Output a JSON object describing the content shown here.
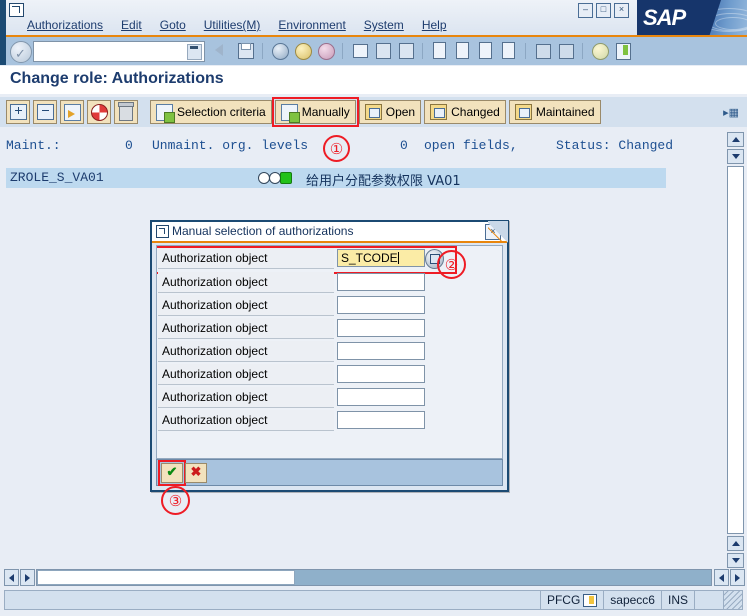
{
  "window": {
    "system_icon": "sap-session-icon",
    "minimize": "–",
    "maximize": "□",
    "close": "×",
    "logo_text": "SAP"
  },
  "menu": {
    "items": [
      {
        "label": "Authorizations",
        "accel": "A"
      },
      {
        "label": "Edit",
        "accel": "E"
      },
      {
        "label": "Goto",
        "accel": "G"
      },
      {
        "label": "Utilities(M)",
        "accel": "M"
      },
      {
        "label": "Environment",
        "accel": "v"
      },
      {
        "label": "System",
        "accel": "y"
      },
      {
        "label": "Help",
        "accel": "H"
      }
    ]
  },
  "command_bar": {
    "command_value": "",
    "command_placeholder": "",
    "enter_icon": "green-check-icon",
    "dropdown_icon": "command-history-icon",
    "icons": [
      "back-icon",
      "save-icon",
      "exit-icon",
      "up-icon",
      "cancel-icon",
      "print-icon",
      "find-icon",
      "find-next-icon",
      "first-page-icon",
      "previous-page-icon",
      "next-page-icon",
      "last-page-icon",
      "new-session-icon",
      "create-shortcut-icon",
      "help-icon",
      "customize-icon"
    ]
  },
  "page": {
    "title": "Change role: Authorizations",
    "right_marker": "list-options-icon"
  },
  "app_toolbar": {
    "icon_buttons": [
      {
        "name": "expand-all-button",
        "icon": "expand-plus-icon"
      },
      {
        "name": "collapse-all-button",
        "icon": "collapse-minus-icon"
      },
      {
        "name": "display-change-button",
        "icon": "document-arrow-icon"
      },
      {
        "name": "traffic-light-button",
        "icon": "red-white-ball-icon"
      },
      {
        "name": "delete-button",
        "icon": "trash-icon"
      }
    ],
    "buttons": [
      {
        "label": "Selection criteria",
        "icon": "selection-criteria-icon",
        "highlighted": false
      },
      {
        "label": "Manually",
        "icon": "manually-icon",
        "highlighted": true
      },
      {
        "label": "Open",
        "icon": "open-icon",
        "highlighted": false
      },
      {
        "label": "Changed",
        "icon": "changed-icon",
        "highlighted": false
      },
      {
        "label": "Maintained",
        "icon": "maintained-icon",
        "highlighted": false
      }
    ]
  },
  "info_line": {
    "maint_label": "Maint.:",
    "maint_count": "0",
    "unmaint_text": "Unmaint. org. levels",
    "open_count": "0",
    "open_text": "open fields,",
    "status_text": "Status: Changed"
  },
  "role_row": {
    "role_name": "ZROLE_S_VA01",
    "description": "给用户分配参数权限 VA01",
    "traffic_light": "green"
  },
  "dialog": {
    "title": "Manual selection of authorizations",
    "close_label": "×",
    "rows": [
      {
        "label": "Authorization object",
        "value": "S_TCODE",
        "filled": true,
        "has_help": true
      },
      {
        "label": "Authorization object",
        "value": "",
        "filled": false,
        "has_help": false
      },
      {
        "label": "Authorization object",
        "value": "",
        "filled": false,
        "has_help": false
      },
      {
        "label": "Authorization object",
        "value": "",
        "filled": false,
        "has_help": false
      },
      {
        "label": "Authorization object",
        "value": "",
        "filled": false,
        "has_help": false
      },
      {
        "label": "Authorization object",
        "value": "",
        "filled": false,
        "has_help": false
      },
      {
        "label": "Authorization object",
        "value": "",
        "filled": false,
        "has_help": false
      },
      {
        "label": "Authorization object",
        "value": "",
        "filled": false,
        "has_help": false
      }
    ],
    "footer": {
      "confirm_label": "✔",
      "cancel_label": "✖"
    }
  },
  "annotations": [
    {
      "id": "1",
      "label": "①"
    },
    {
      "id": "2",
      "label": "②"
    },
    {
      "id": "3",
      "label": "③"
    }
  ],
  "scrollbars": {
    "v_up": "▲",
    "v_down": "▼",
    "h_left": "◀",
    "h_right": "▶"
  },
  "status_bar": {
    "transaction": "PFCG",
    "transaction_icon": "session-info-icon",
    "server": "sapecc6",
    "insert_mode": "INS",
    "message": ""
  },
  "colors": {
    "accent_orange": "#e8860d",
    "sap_blue": "#16356b",
    "highlight_red": "#ee1c25",
    "field_yellow": "#fbeca6",
    "button_tan": "#f2e2bd"
  }
}
